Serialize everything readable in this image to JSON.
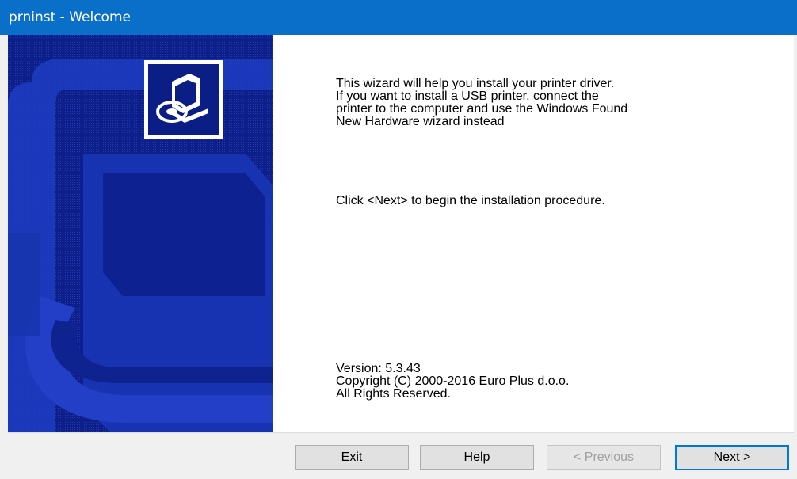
{
  "window": {
    "title": "prninst - Welcome"
  },
  "content": {
    "intro_lines": [
      "This wizard will help you install your printer driver.",
      "If you want to install a USB printer, connect the",
      "printer to the computer and use the Windows Found",
      "New Hardware wizard instead"
    ],
    "instruction": "Click <Next> to begin the installation procedure.",
    "version": "Version: 5.3.43",
    "copyright": "Copyright (C) 2000-2016 Euro Plus d.o.o.",
    "rights": "All Rights Reserved."
  },
  "buttons": {
    "exit": {
      "mnemonic": "E",
      "rest": "xit"
    },
    "help": {
      "mnemonic": "H",
      "rest": "elp"
    },
    "previous": {
      "pre": "< ",
      "mnemonic": "P",
      "rest": "revious"
    },
    "next": {
      "mnemonic": "N",
      "rest": "ext >"
    }
  },
  "icons": {
    "banner": "printer-cd-icon"
  },
  "colors": {
    "titlebar": "#0a6fc9",
    "banner": "#0b1e86",
    "default_button_border": "#0078d7"
  }
}
